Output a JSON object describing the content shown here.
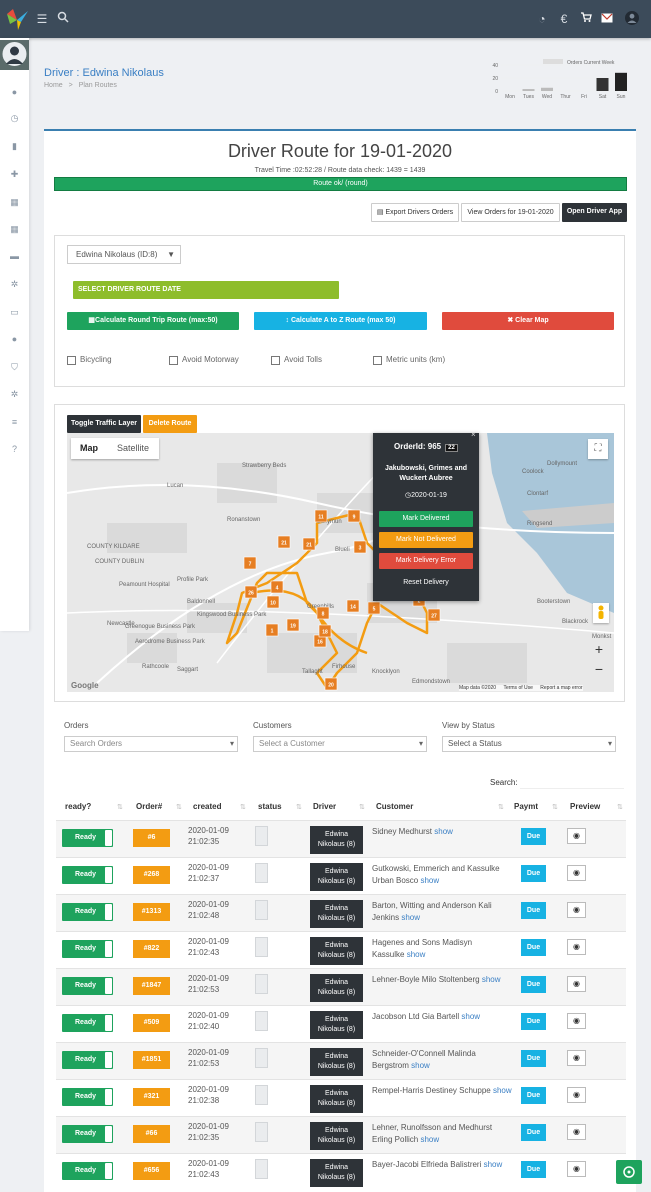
{
  "topbar": {
    "icons": [
      "logo-icon",
      "menu-icon",
      "search-icon",
      "gauge-icon",
      "euro-icon",
      "cart-icon",
      "mail-icon",
      "user-icon"
    ]
  },
  "header": {
    "title": "Driver : Edwina Nikolaus",
    "breadcrumb": [
      "Home",
      "Plan Routes"
    ]
  },
  "mini_chart": {
    "type": "bar",
    "title": "Orders Current Week",
    "categories": [
      "Mon",
      "Tues",
      "Wed",
      "Thur",
      "Fri",
      "Sat",
      "Sun"
    ],
    "values": [
      0,
      3,
      5,
      0,
      0,
      20,
      28
    ],
    "ylim": [
      0,
      40
    ],
    "yticks": [
      "40",
      "20",
      "0"
    ]
  },
  "route": {
    "title": "Driver Route for 19-01-2020",
    "subtitle": "Travel Time :02:52:28 / Route data check: 1439 = 1439",
    "status": "Route ok/ (round)"
  },
  "actions": {
    "export": "Export Drivers Orders",
    "view": "View Orders for 19-01-2020",
    "open": "Open Driver App"
  },
  "planner": {
    "driver_select": "Edwina Nikolaus (ID:8)",
    "date_btn": "SELECT DRIVER ROUTE DATE",
    "round_trip": "Calculate Round Trip Route (max:50)",
    "atoz": "Calculate A to Z Route (max 50)",
    "clear": "Clear Map",
    "opts": [
      "Bicycling",
      "Avoid Motorway",
      "Avoid Tolls",
      "Metric units (km)"
    ]
  },
  "map": {
    "toggle": "Toggle Traffic Layer",
    "delete": "Delete Route",
    "tab_map": "Map",
    "tab_sat": "Satellite",
    "popup": {
      "order": "OrderId: 965",
      "badge": "22",
      "company": "Jakubowski, Grimes and Wuckert Aubree",
      "date": "2020-01-19",
      "mark_del": "Mark Delivered",
      "mark_not": "Mark Not Delivered",
      "mark_err": "Mark Delivery Error",
      "reset": "Reset Delivery"
    },
    "labels": [
      "Strawberry Beds",
      "Lucan",
      "Ronanstown",
      "COUNTY KILDARE",
      "COUNTY DUBLIN",
      "Peamount Hospital",
      "Profile Park",
      "Baldonnell",
      "Kingswood Business Park",
      "Newcastle",
      "Greenogue Business Park",
      "Aerodrome Business Park",
      "Rathcoole",
      "Saggart",
      "Tallaght",
      "Firhouse",
      "Knocklyon",
      "Edmondstown",
      "Greenhills",
      "Ballymun",
      "Coolock",
      "Clontarf",
      "Dollymount",
      "Ringsend",
      "Booterstown",
      "Blackrock",
      "Monkst",
      "Blueli"
    ],
    "markers": [
      "11",
      "9",
      "21",
      "21",
      "3",
      "7",
      "4",
      "26",
      "10",
      "8",
      "14",
      "5",
      "1",
      "19",
      "16",
      "18",
      "20",
      "27",
      "2"
    ],
    "footer": [
      "Map data ©2020",
      "Terms of Use",
      "Report a map error"
    ],
    "google": "Google"
  },
  "filters": {
    "orders_label": "Orders",
    "orders_ph": "Search Orders",
    "customers_label": "Customers",
    "customers_ph": "Select a Customer",
    "status_label": "View by Status",
    "status_ph": "Select a Status",
    "search_label": "Search:"
  },
  "table": {
    "headers": [
      "ready?",
      "Order#",
      "created",
      "status",
      "Driver",
      "Customer",
      "Paymt",
      "Preview"
    ],
    "rows": [
      {
        "ready": "Ready",
        "order": "#6",
        "date": "2020-01-09",
        "time": "21:02:35",
        "driver1": "Edwina",
        "driver2": "Nikolaus (8)",
        "cust1": "Sidney Medhurst",
        "cust2": "",
        "pay": "Due"
      },
      {
        "ready": "Ready",
        "order": "#268",
        "date": "2020-01-09",
        "time": "21:02:37",
        "driver1": "Edwina",
        "driver2": "Nikolaus (8)",
        "cust1": "Gutkowski, Emmerich and Kassulke",
        "cust2": "Urban Bosco",
        "pay": "Due"
      },
      {
        "ready": "Ready",
        "order": "#1313",
        "date": "2020-01-09",
        "time": "21:02:48",
        "driver1": "Edwina",
        "driver2": "Nikolaus (8)",
        "cust1": "Barton, Witting and Anderson Kali",
        "cust2": "Jenkins",
        "pay": "Due"
      },
      {
        "ready": "Ready",
        "order": "#822",
        "date": "2020-01-09",
        "time": "21:02:43",
        "driver1": "Edwina",
        "driver2": "Nikolaus (8)",
        "cust1": "Hagenes and Sons Madisyn",
        "cust2": "Kassulke",
        "pay": "Due"
      },
      {
        "ready": "Ready",
        "order": "#1847",
        "date": "2020-01-09",
        "time": "21:02:53",
        "driver1": "Edwina",
        "driver2": "Nikolaus (8)",
        "cust1": "Lehner-Boyle Milo Stoltenberg",
        "cust2": "",
        "pay": "Due"
      },
      {
        "ready": "Ready",
        "order": "#509",
        "date": "2020-01-09",
        "time": "21:02:40",
        "driver1": "Edwina",
        "driver2": "Nikolaus (8)",
        "cust1": "Jacobson Ltd Gia Bartell",
        "cust2": "",
        "pay": "Due"
      },
      {
        "ready": "Ready",
        "order": "#1851",
        "date": "2020-01-09",
        "time": "21:02:53",
        "driver1": "Edwina",
        "driver2": "Nikolaus (8)",
        "cust1": "Schneider-O'Connell Malinda",
        "cust2": "Bergstrom",
        "pay": "Due"
      },
      {
        "ready": "Ready",
        "order": "#321",
        "date": "2020-01-09",
        "time": "21:02:38",
        "driver1": "Edwina",
        "driver2": "Nikolaus (8)",
        "cust1": "Rempel-Harris Destiney Schuppe",
        "cust2": "",
        "pay": "Due"
      },
      {
        "ready": "Ready",
        "order": "#66",
        "date": "2020-01-09",
        "time": "21:02:35",
        "driver1": "Edwina",
        "driver2": "Nikolaus (8)",
        "cust1": "Lehner, Runolfsson and Medhurst",
        "cust2": "Erling Pollich",
        "pay": "Due"
      },
      {
        "ready": "Ready",
        "order": "#656",
        "date": "2020-01-09",
        "time": "21:02:43",
        "driver1": "Edwina",
        "driver2": "Nikolaus (8)",
        "cust1": "Bayer-Jacobi Elfrieda Balistreri",
        "cust2": "",
        "pay": "Due"
      }
    ],
    "show": "show"
  }
}
